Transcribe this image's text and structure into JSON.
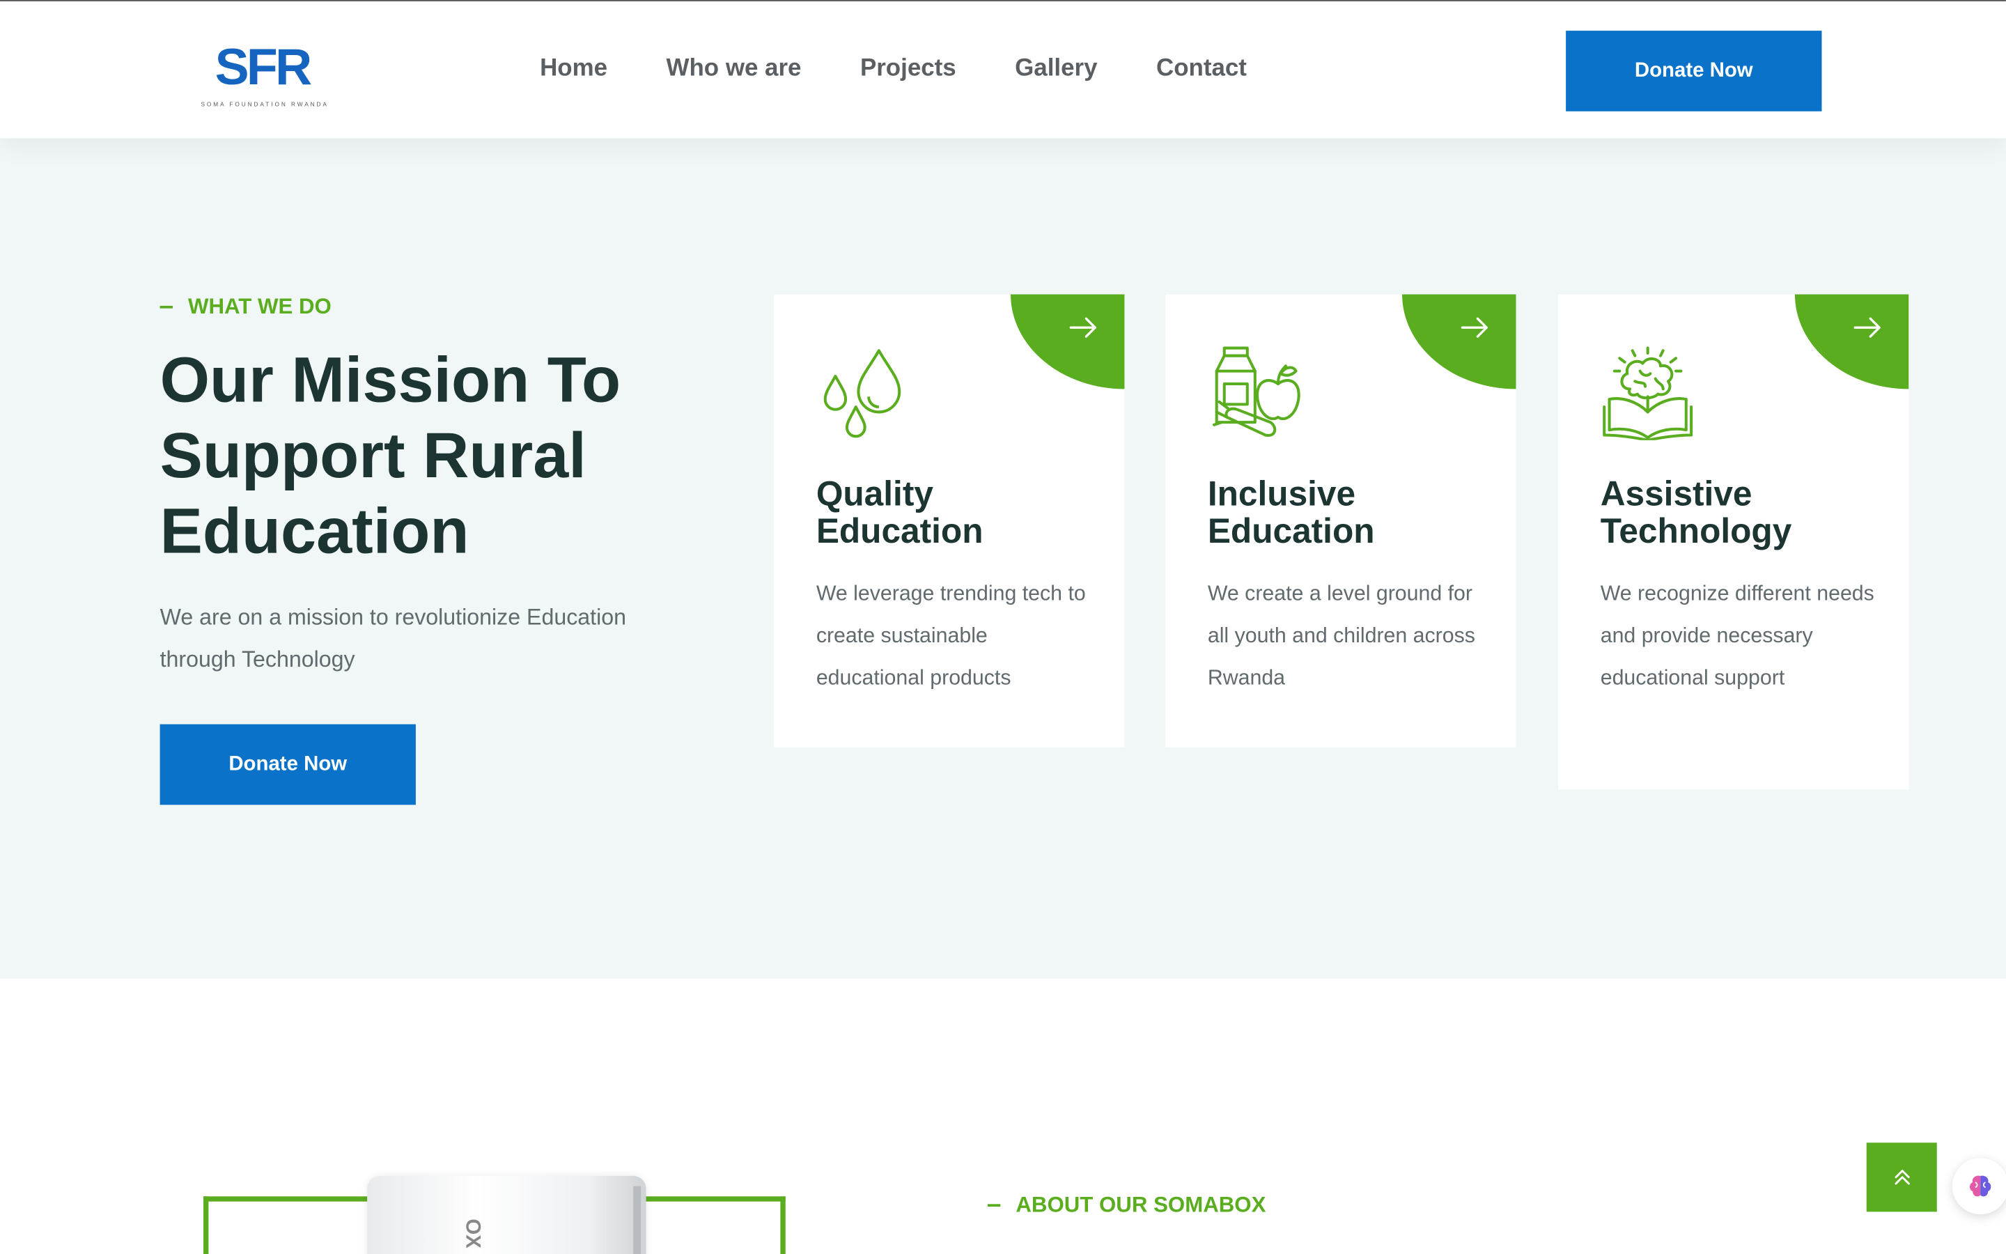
{
  "header": {
    "logo_mark": "SFR",
    "logo_subtitle": "SOMA FOUNDATION RWANDA",
    "nav": [
      "Home",
      "Who we are",
      "Projects",
      "Gallery",
      "Contact"
    ],
    "donate_label": "Donate Now"
  },
  "hero": {
    "kicker": "WHAT WE DO",
    "title": "Our Mission To Support Rural Education",
    "text": "We are on a mission to revolutionize Education through Technology",
    "donate_label": "Donate Now",
    "cards": [
      {
        "title": "Quality Education",
        "text": "We leverage trending tech to create sustainable educational products",
        "icon": "water-drops-icon"
      },
      {
        "title": "Inclusive Education",
        "text": "We create a level ground for all youth and children across Rwanda",
        "icon": "food-nutrition-icon"
      },
      {
        "title": "Assistive Technology",
        "text": "We recognize different needs and provide necessary educational support",
        "icon": "brain-book-icon"
      }
    ]
  },
  "about": {
    "kicker": "ABOUT OUR SOMABOX",
    "device_label": "OX"
  },
  "colors": {
    "brand_blue": "#0a72c8",
    "accent_green": "#5aad1f",
    "heading": "#1c3532",
    "section_bg": "#f1f6f6"
  }
}
